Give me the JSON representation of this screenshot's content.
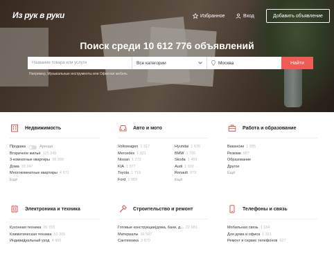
{
  "header": {
    "logo": "Из рук в руки",
    "favorites": "Избранное",
    "login": "Вход",
    "add_ad": "Добавить объявление"
  },
  "hero": {
    "title": "Поиск среди 10 612 776 объявлений",
    "search_placeholder": "Название товара или услуги",
    "category_value": "Все категории",
    "city_value": "Москва",
    "find_button": "Найти",
    "hint": "Например, Музыкальные инструменты или Офисная мебель"
  },
  "categories": {
    "realty": {
      "title": "Недвижимость",
      "toggle_left": "Продажа",
      "toggle_right": "Аренда",
      "items": [
        {
          "label": "Вторичное жильё",
          "count": "125 345"
        },
        {
          "label": "3-комнатные квартиры",
          "count": "36 399"
        },
        {
          "label": "Дома",
          "count": "33 247"
        },
        {
          "label": "Многокомнатные квартиры",
          "count": "4 571"
        }
      ],
      "more": "Ещё"
    },
    "auto": {
      "title": "Авто и мото",
      "items": [
        {
          "label": "Volkswagen",
          "count": "1 317"
        },
        {
          "label": "Hyundai",
          "count": "1 676"
        },
        {
          "label": "Mercedes",
          "count": "1 021"
        },
        {
          "label": "BMW",
          "count": "1 765"
        },
        {
          "label": "Nissan",
          "count": "1 272"
        },
        {
          "label": "Skoda",
          "count": "1 469"
        },
        {
          "label": "KIA",
          "count": "1 377"
        },
        {
          "label": "Audi",
          "count": "1 002"
        },
        {
          "label": "Toyota",
          "count": "1 719"
        },
        {
          "label": "Renault",
          "count": "973"
        },
        {
          "label": "Ford",
          "count": "1 083"
        },
        {
          "label": "Ещё",
          "count": ""
        }
      ]
    },
    "jobs": {
      "title": "Работа и образование",
      "items": [
        {
          "label": "Вакансии",
          "count": "1 935"
        },
        {
          "label": "Резюме",
          "count": "987"
        },
        {
          "label": "Образование",
          "count": ""
        },
        {
          "label": "Другое",
          "count": ""
        }
      ],
      "more": "Ещё"
    },
    "electronics": {
      "title": "Электроника и техника",
      "items": [
        {
          "label": "Кухонная техника",
          "count": "26 703"
        },
        {
          "label": "Климатическая техника",
          "count": "10 305"
        },
        {
          "label": "Индивидуальный уход",
          "count": "4 960"
        }
      ]
    },
    "construction": {
      "title": "Строительство и ремонт",
      "items": [
        {
          "label": "Готовые конструкции(дома, бани, д...",
          "count": "22 981"
        },
        {
          "label": "Материалы",
          "count": "39 587"
        },
        {
          "label": "Сантехника",
          "count": "3 870"
        }
      ]
    },
    "phones": {
      "title": "Телефоны и связь",
      "items": [
        {
          "label": "Мобильная связь",
          "count": "1 184"
        },
        {
          "label": "Для дома и офиса",
          "count": "1 321"
        },
        {
          "label": "Ремонт и сервис телефонов",
          "count": "627"
        }
      ]
    }
  },
  "colors": {
    "accent": "#f25a55",
    "icon_red": "#e8504b"
  }
}
